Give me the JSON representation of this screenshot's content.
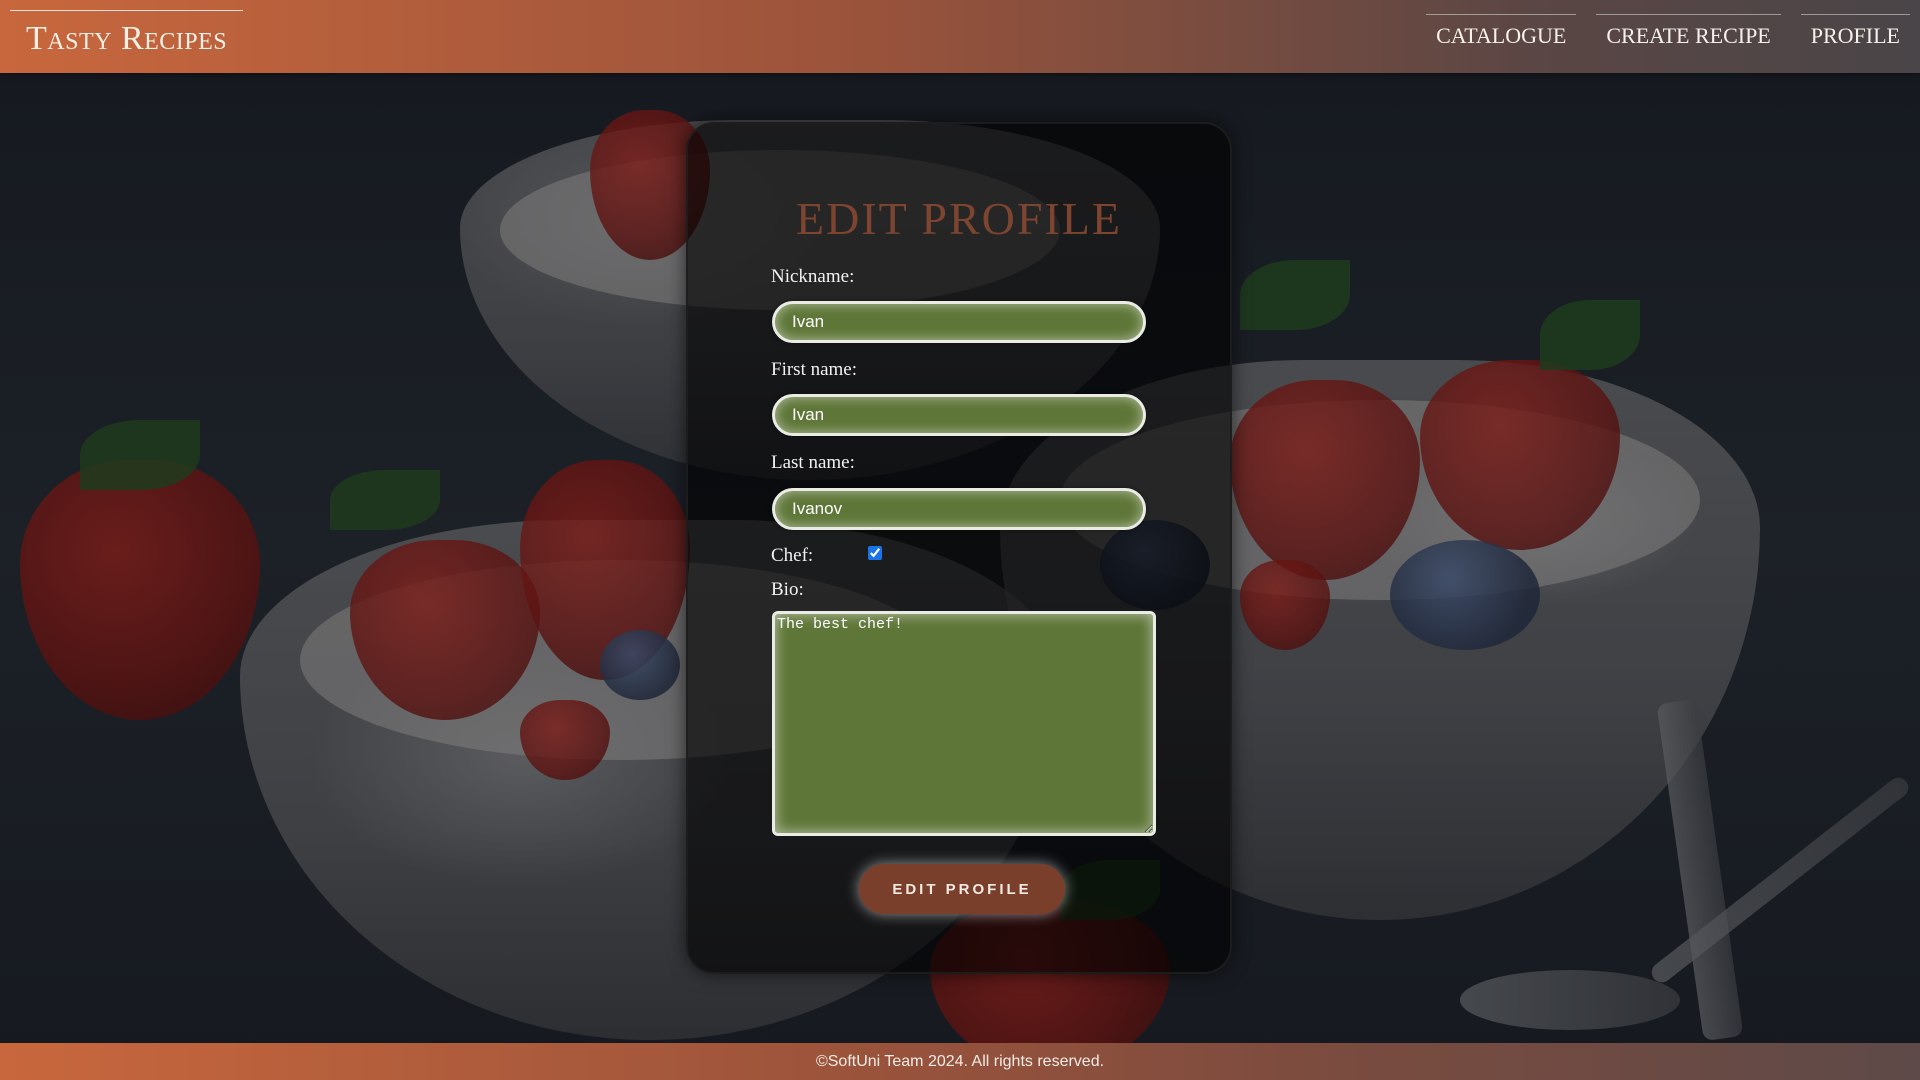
{
  "header": {
    "logo": "Tasty Recipes",
    "nav": [
      {
        "label": "Catalogue"
      },
      {
        "label": "Create Recipe"
      },
      {
        "label": "Profile"
      }
    ]
  },
  "form": {
    "title": "Edit Profile",
    "nickname": {
      "label": "Nickname:",
      "value": "Ivan"
    },
    "first_name": {
      "label": "First name:",
      "value": "Ivan"
    },
    "last_name": {
      "label": "Last name:",
      "value": "Ivanov"
    },
    "chef": {
      "label": "Chef:",
      "checked": true
    },
    "bio": {
      "label": "Bio:",
      "value": "The best chef!"
    },
    "submit_label": "Edit Profile"
  },
  "footer": {
    "text": "©SoftUni Team 2024. All rights reserved."
  },
  "colors": {
    "header_start": "#c8673d",
    "header_end": "#4a4548",
    "field_bg": "#5e7637",
    "title": "#7d4530",
    "button_bg": "#7a3f2a"
  }
}
